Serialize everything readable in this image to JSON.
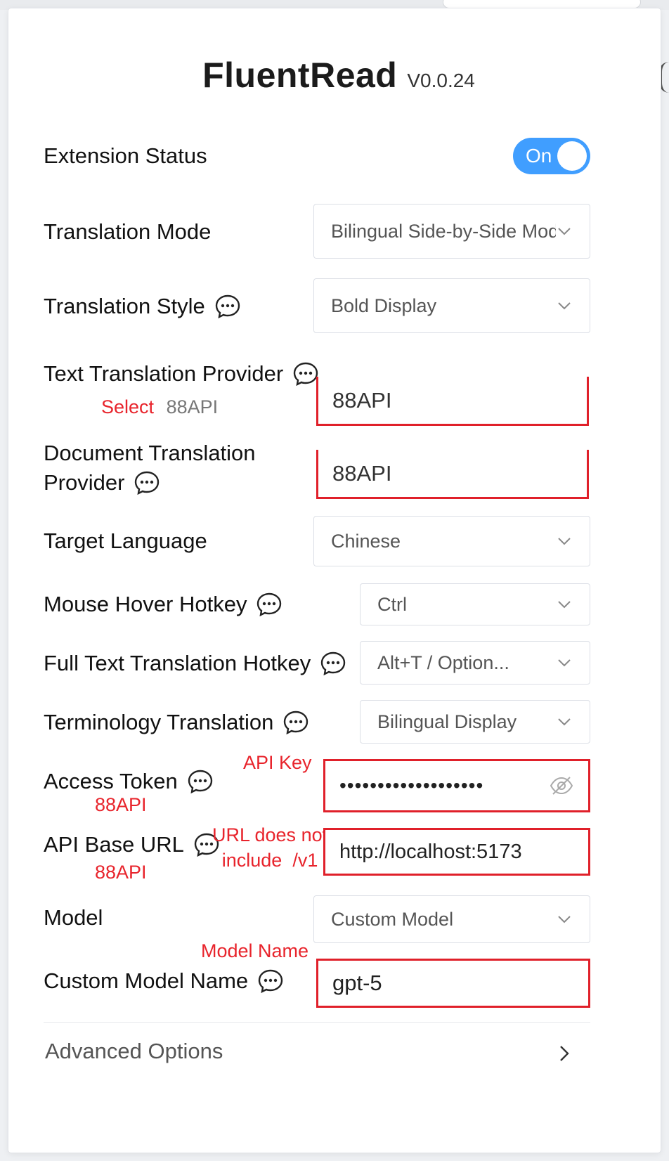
{
  "header": {
    "title": "FluentRead",
    "version": "V0.0.24"
  },
  "extension_status": {
    "label": "Extension Status",
    "toggle": "On"
  },
  "translation_mode": {
    "label": "Translation Mode",
    "value": "Bilingual Side-by-Side Mode"
  },
  "translation_style": {
    "label": "Translation Style",
    "value": "Bold Display"
  },
  "text_provider": {
    "label": "Text Translation Provider",
    "value": "88API",
    "annotation_word": "Select",
    "annotation_value": "88API"
  },
  "document_provider": {
    "label_line1": "Document Translation",
    "label_line2": "Provider",
    "value": "88API"
  },
  "target_language": {
    "label": "Target Language",
    "value": "Chinese"
  },
  "hover_hotkey": {
    "label": "Mouse Hover Hotkey",
    "value": "Ctrl"
  },
  "full_text_hotkey": {
    "label": "Full Text Translation Hotkey",
    "value": "Alt+T / Option..."
  },
  "terminology": {
    "label": "Terminology Translation",
    "value": "Bilingual Display"
  },
  "access_token": {
    "label": "Access Token",
    "annotation": "API Key",
    "sub_annotation": "88API",
    "value": "•••••••••••••••••••"
  },
  "api_base_url": {
    "label": "API Base URL",
    "annotation_line1": "URL does not",
    "annotation_line2": "include  /v1",
    "sub_annotation": "88API",
    "value": "http://localhost:5173"
  },
  "model": {
    "label": "Model",
    "value": "Custom Model"
  },
  "custom_model": {
    "label": "Custom Model Name",
    "annotation": "Model Name",
    "value": "gpt-5"
  },
  "advanced": {
    "label": "Advanced Options"
  },
  "colors": {
    "accent": "#409eff",
    "annotation_red": "#e0202a",
    "border": "#dcdfe6"
  }
}
